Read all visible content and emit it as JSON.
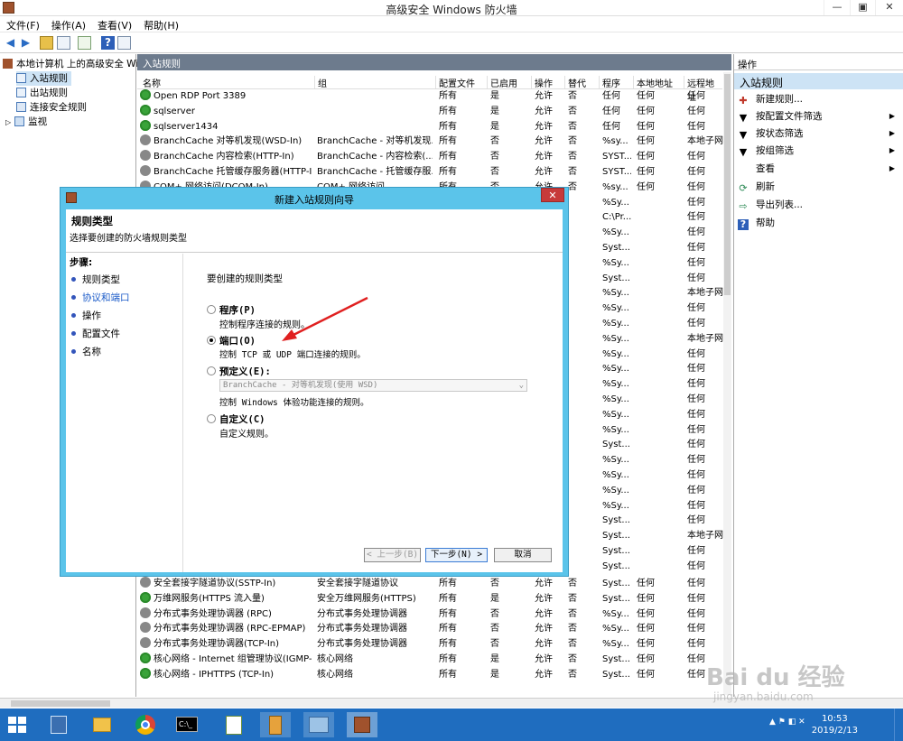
{
  "window": {
    "title": "高级安全 Windows 防火墙",
    "min": "—",
    "max": "▣",
    "close": "✕"
  },
  "menu": [
    "文件(F)",
    "操作(A)",
    "查看(V)",
    "帮助(H)"
  ],
  "tree": {
    "root": "本地计算机 上的高级安全 Win",
    "items": [
      "入站规则",
      "出站规则",
      "连接安全规则",
      "监视"
    ]
  },
  "center": {
    "header": "入站规则",
    "columns": [
      "名称",
      "组",
      "配置文件",
      "已启用",
      "操作",
      "替代",
      "程序",
      "本地地址",
      "远程地址"
    ],
    "rows": [
      {
        "icon": "g",
        "name": "Open RDP Port 3389",
        "group": "",
        "profile": "所有",
        "enabled": "是",
        "action": "允许",
        "override": "否",
        "program": "任何",
        "local": "任何",
        "remote": "任何"
      },
      {
        "icon": "g",
        "name": "sqlserver",
        "group": "",
        "profile": "所有",
        "enabled": "是",
        "action": "允许",
        "override": "否",
        "program": "任何",
        "local": "任何",
        "remote": "任何"
      },
      {
        "icon": "g",
        "name": "sqlserver1434",
        "group": "",
        "profile": "所有",
        "enabled": "是",
        "action": "允许",
        "override": "否",
        "program": "任何",
        "local": "任何",
        "remote": "任何"
      },
      {
        "icon": "x",
        "name": "BranchCache 对等机发现(WSD-In)",
        "group": "BranchCache - 对等机发现...",
        "profile": "所有",
        "enabled": "否",
        "action": "允许",
        "override": "否",
        "program": "%sy...",
        "local": "任何",
        "remote": "本地子网"
      },
      {
        "icon": "x",
        "name": "BranchCache 内容检索(HTTP-In)",
        "group": "BranchCache - 内容检索(...",
        "profile": "所有",
        "enabled": "否",
        "action": "允许",
        "override": "否",
        "program": "SYST...",
        "local": "任何",
        "remote": "任何"
      },
      {
        "icon": "x",
        "name": "BranchCache 托管缓存服务器(HTTP-In)",
        "group": "BranchCache - 托管缓存服...",
        "profile": "所有",
        "enabled": "否",
        "action": "允许",
        "override": "否",
        "program": "SYST...",
        "local": "任何",
        "remote": "任何"
      },
      {
        "icon": "x",
        "name": "COM+ 网络访问(DCOM-In)",
        "group": "COM+ 网络访问",
        "profile": "所有",
        "enabled": "否",
        "action": "允许",
        "override": "否",
        "program": "%sy...",
        "local": "任何",
        "remote": "任何"
      }
    ],
    "hidden_rows": [
      {
        "program": "%Sy...",
        "remote": "任何"
      },
      {
        "program": "C:\\Pr...",
        "remote": "任何"
      },
      {
        "program": "%Sy...",
        "remote": "任何"
      },
      {
        "program": "Syst...",
        "remote": "任何"
      },
      {
        "program": "%Sy...",
        "remote": "任何"
      },
      {
        "program": "Syst...",
        "remote": "任何"
      },
      {
        "program": "%Sy...",
        "remote": "本地子网"
      },
      {
        "program": "%Sy...",
        "remote": "任何"
      },
      {
        "program": "%Sy...",
        "remote": "任何"
      },
      {
        "program": "%Sy...",
        "remote": "本地子网"
      },
      {
        "program": "%Sy...",
        "remote": "任何"
      },
      {
        "program": "%Sy...",
        "remote": "任何"
      },
      {
        "program": "%Sy...",
        "remote": "任何"
      },
      {
        "program": "%Sy...",
        "remote": "任何"
      },
      {
        "program": "%Sy...",
        "remote": "任何"
      },
      {
        "program": "%Sy...",
        "remote": "任何"
      },
      {
        "program": "Syst...",
        "remote": "任何"
      },
      {
        "program": "%Sy...",
        "remote": "任何"
      },
      {
        "program": "%Sy...",
        "remote": "任何"
      },
      {
        "program": "%Sy...",
        "remote": "任何"
      },
      {
        "program": "%Sy...",
        "remote": "任何"
      },
      {
        "program": "Syst...",
        "remote": "任何"
      },
      {
        "program": "Syst...",
        "remote": "本地子网"
      },
      {
        "program": "Syst...",
        "remote": "任何"
      },
      {
        "program": "Syst...",
        "remote": "任何"
      }
    ],
    "bottom_rows": [
      {
        "icon": "x",
        "name": "安全套接字隧道协议(SSTP-In)",
        "group": "安全套接字隧道协议",
        "profile": "所有",
        "enabled": "否",
        "action": "允许",
        "override": "否",
        "program": "Syst...",
        "local": "任何",
        "remote": "任何"
      },
      {
        "icon": "g",
        "name": "万维网服务(HTTPS 流入量)",
        "group": "安全万维网服务(HTTPS)",
        "profile": "所有",
        "enabled": "是",
        "action": "允许",
        "override": "否",
        "program": "Syst...",
        "local": "任何",
        "remote": "任何"
      },
      {
        "icon": "x",
        "name": "分布式事务处理协调器 (RPC)",
        "group": "分布式事务处理协调器",
        "profile": "所有",
        "enabled": "否",
        "action": "允许",
        "override": "否",
        "program": "%Sy...",
        "local": "任何",
        "remote": "任何"
      },
      {
        "icon": "x",
        "name": "分布式事务处理协调器 (RPC-EPMAP)",
        "group": "分布式事务处理协调器",
        "profile": "所有",
        "enabled": "否",
        "action": "允许",
        "override": "否",
        "program": "%Sy...",
        "local": "任何",
        "remote": "任何"
      },
      {
        "icon": "x",
        "name": "分布式事务处理协调器(TCP-In)",
        "group": "分布式事务处理协调器",
        "profile": "所有",
        "enabled": "否",
        "action": "允许",
        "override": "否",
        "program": "%Sy...",
        "local": "任何",
        "remote": "任何"
      },
      {
        "icon": "g",
        "name": "核心网络 - Internet 组管理协议(IGMP-In)",
        "group": "核心网络",
        "profile": "所有",
        "enabled": "是",
        "action": "允许",
        "override": "否",
        "program": "Syst...",
        "local": "任何",
        "remote": "任何"
      },
      {
        "icon": "g",
        "name": "核心网络 - IPHTTPS (TCP-In)",
        "group": "核心网络",
        "profile": "所有",
        "enabled": "是",
        "action": "允许",
        "override": "否",
        "program": "Syst...",
        "local": "任何",
        "remote": "任何"
      }
    ]
  },
  "actions": {
    "header": "操作",
    "sub": "入站规则",
    "items": [
      {
        "label": "新建规则...",
        "arrow": ""
      },
      {
        "label": "按配置文件筛选",
        "arrow": "▶"
      },
      {
        "label": "按状态筛选",
        "arrow": "▶"
      },
      {
        "label": "按组筛选",
        "arrow": "▶"
      },
      {
        "label": "查看",
        "arrow": "▶"
      },
      {
        "label": "刷新",
        "arrow": ""
      },
      {
        "label": "导出列表...",
        "arrow": ""
      },
      {
        "label": "帮助",
        "arrow": ""
      }
    ]
  },
  "dialog": {
    "title": "新建入站规则向导",
    "close": "✕",
    "heading": "规则类型",
    "subheading": "选择要创建的防火墙规则类型",
    "steps_label": "步骤:",
    "steps": [
      "规则类型",
      "协议和端口",
      "操作",
      "配置文件",
      "名称"
    ],
    "prompt": "要创建的规则类型",
    "options": [
      {
        "label": "程序(P)",
        "desc": "控制程序连接的规则。",
        "selected": false
      },
      {
        "label": "端口(O)",
        "desc": "控制 TCP 或 UDP 端口连接的规则。",
        "selected": true
      },
      {
        "label": "预定义(E):",
        "desc": "控制 Windows 体验功能连接的规则。",
        "selected": false
      },
      {
        "label": "自定义(C)",
        "desc": "自定义规则。",
        "selected": false
      }
    ],
    "predefined_select": "BranchCache - 对等机发现(使用 WSD)",
    "buttons": {
      "back": "< 上一步(B)",
      "next": "下一步(N) >",
      "cancel": "取消"
    }
  },
  "taskbar": {
    "time": "10:53",
    "date": "2019/2/13"
  },
  "watermark": {
    "line1": "Bai du 经验",
    "line2": "jingyan.baidu.com"
  },
  "colors": {
    "taskbar": "#1f6dbf",
    "dialog_frame": "#5bc4ea",
    "close_red": "#c73a3a",
    "header_gray": "#6d7b8d",
    "selected_blue": "#cde3f5",
    "arrow_red": "#e02020"
  }
}
